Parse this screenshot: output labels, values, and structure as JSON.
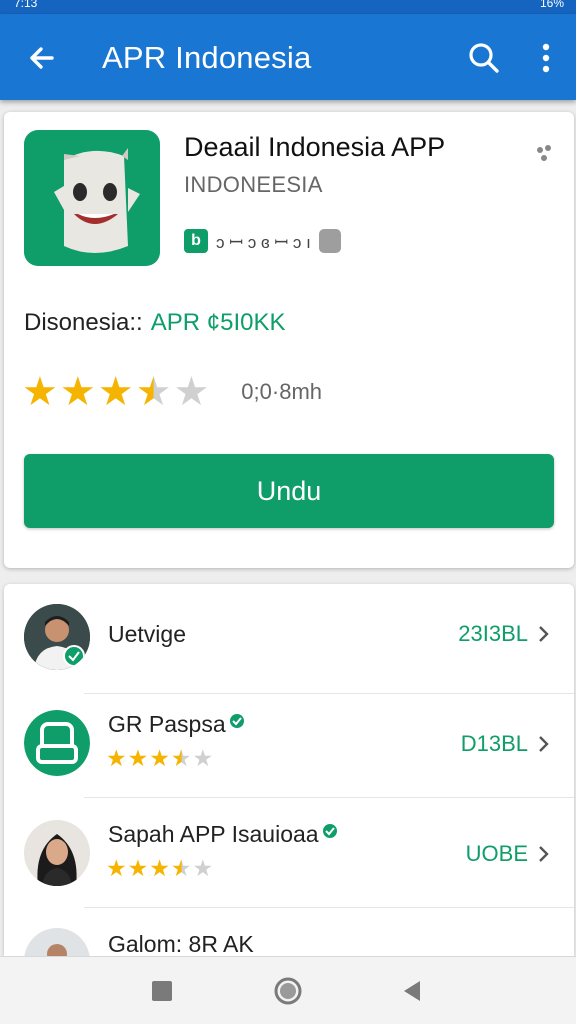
{
  "status_bar": {
    "time": "7:13",
    "battery": "16%"
  },
  "app_bar": {
    "title": "APR Indonesia"
  },
  "app": {
    "name": "Deaail Indonesia APP",
    "developer": "INDONEESIA",
    "badge_letter": "b",
    "badge_text": "ɔ ꟷ ɔ ɞ ꟷ ɔ ı",
    "price_label": "Disonesia::",
    "price_value": "APR ¢5I0KK",
    "rating": 3.5,
    "rating_max": 5,
    "rating_meta": "0;0·8mh",
    "install_label": "Undu"
  },
  "list": [
    {
      "name": "Uetvige",
      "value": "23I3BL",
      "rating": null,
      "verified": false
    },
    {
      "name": "GR Paspsa",
      "value": "D13BL",
      "rating": 3.5,
      "verified": true
    },
    {
      "name": "Sapah APP Isauioaa",
      "value": "UOBE",
      "rating": 3.5,
      "verified": true
    },
    {
      "name": "Galom: 8R AK",
      "value": "",
      "rating": null,
      "verified": false
    }
  ],
  "colors": {
    "primary": "#1976d2",
    "accent": "#0f9d6a",
    "star": "#f4b400"
  },
  "icons": [
    "back-arrow-icon",
    "search-icon",
    "more-vert-icon",
    "chevron-right-icon",
    "verified-icon",
    "nav-square-icon",
    "nav-circle-icon",
    "nav-back-icon"
  ]
}
